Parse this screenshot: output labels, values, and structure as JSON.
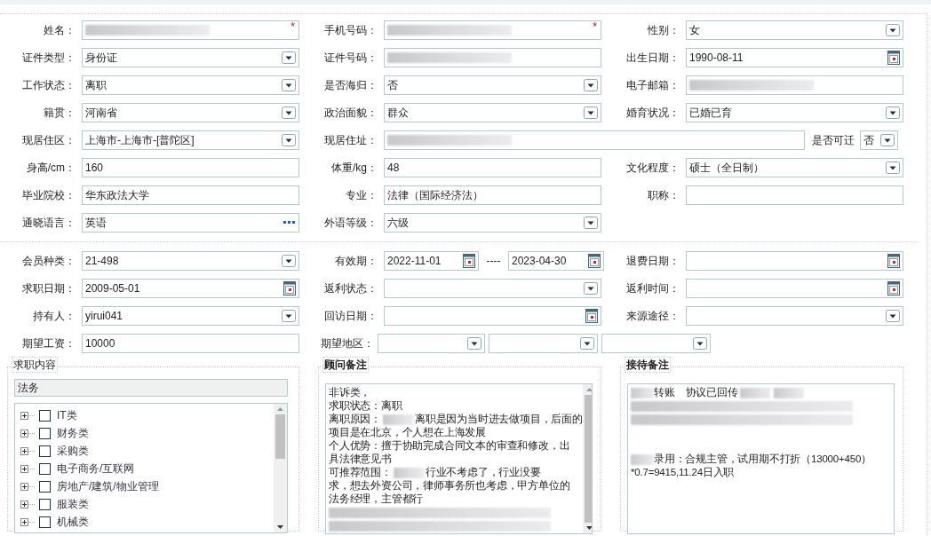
{
  "section_1": {
    "rows": [
      [
        {
          "label": "姓名：",
          "kind": "redacted",
          "required_mark": "*"
        },
        {
          "label": "手机号码：",
          "kind": "redacted",
          "required_mark": "*"
        },
        {
          "label": "性别：",
          "kind": "select",
          "value": "女"
        }
      ],
      [
        {
          "label": "证件类型：",
          "kind": "select",
          "value": "身份证"
        },
        {
          "label": "证件号码：",
          "kind": "redacted"
        },
        {
          "label": "出生日期：",
          "kind": "date",
          "value": "1990-08-11"
        }
      ],
      [
        {
          "label": "工作状态：",
          "kind": "select",
          "value": "离职"
        },
        {
          "label": "是否海归：",
          "kind": "select",
          "value": "否"
        },
        {
          "label": "电子邮箱：",
          "kind": "redacted"
        }
      ],
      [
        {
          "label": "籍贯：",
          "kind": "select",
          "value": "河南省"
        },
        {
          "label": "政治面貌：",
          "kind": "select",
          "value": "群众"
        },
        {
          "label": "婚育状况：",
          "kind": "select",
          "value": "已婚已育"
        }
      ],
      [
        {
          "label": "现居住区：",
          "kind": "select",
          "value": "上海市-上海市-[普陀区]"
        },
        {
          "label": "现居住址：",
          "kind": "redacted-wide"
        },
        {
          "label": "是否可迁",
          "kind": "inline-select",
          "value": "否"
        }
      ],
      [
        {
          "label": "身高/cm：",
          "kind": "text",
          "value": "160"
        },
        {
          "label": "体重/kg：",
          "kind": "text",
          "value": "48"
        },
        {
          "label": "文化程度：",
          "kind": "select",
          "value": "硕士（全日制）"
        }
      ],
      [
        {
          "label": "毕业院校：",
          "kind": "text",
          "value": "华东政法大学"
        },
        {
          "label": "专业：",
          "kind": "text",
          "value": "法律（国际经济法）"
        },
        {
          "label": "职称：",
          "kind": "text"
        }
      ],
      [
        {
          "label": "通晓语言：",
          "kind": "lookup",
          "value": "英语"
        },
        {
          "label": "外语等级：",
          "kind": "select",
          "value": "六级"
        }
      ]
    ]
  },
  "section_2": {
    "rows": [
      [
        {
          "label": "会员种类：",
          "kind": "select",
          "value": "21-498"
        },
        {
          "label": "有效期：",
          "kind": "date-range",
          "from": "2022-11-01",
          "separator": "----",
          "to": "2023-04-30"
        },
        {
          "label": "退费日期：",
          "kind": "date"
        }
      ],
      [
        {
          "label": "求职日期：",
          "kind": "date",
          "value": "2009-05-01"
        },
        {
          "label": "返利状态：",
          "kind": "select"
        },
        {
          "label": "返利时间：",
          "kind": "date"
        }
      ],
      [
        {
          "label": "持有人：",
          "kind": "select",
          "value": "yirui041"
        },
        {
          "label": "回访日期：",
          "kind": "date"
        },
        {
          "label": "来源途径：",
          "kind": "select"
        }
      ],
      [
        {
          "label": "期望工资：",
          "kind": "text",
          "value": "10000"
        },
        {
          "label": "期望地区：",
          "kind": "triple-select"
        }
      ]
    ]
  },
  "job_content": {
    "legend": "求职内容",
    "filter": "法务",
    "items": [
      {
        "label": "IT类",
        "expanded": false,
        "checked": false
      },
      {
        "label": "财务类",
        "expanded": false,
        "checked": false
      },
      {
        "label": "采购类",
        "expanded": false,
        "checked": false
      },
      {
        "label": "电子商务/互联网",
        "expanded": false,
        "checked": false
      },
      {
        "label": "房地产/建筑/物业管理",
        "expanded": false,
        "checked": false
      },
      {
        "label": "服装类",
        "expanded": false,
        "checked": false
      },
      {
        "label": "机械类",
        "expanded": false,
        "checked": false
      }
    ]
  },
  "consultant_notes": {
    "legend": "顾问备注",
    "lines": [
      [
        {
          "kind": "text",
          "text": "非诉类，"
        }
      ],
      [
        {
          "kind": "text",
          "text": "求职状态：离职"
        }
      ],
      [
        {
          "kind": "text",
          "text": "离职原因："
        },
        {
          "kind": "redacted"
        },
        {
          "kind": "text",
          "text": "离职是因为当时进去做项目，后面的"
        }
      ],
      [
        {
          "kind": "text",
          "text": "项目是在北京，个人想在上海发展"
        }
      ],
      [
        {
          "kind": "text",
          "text": "个人优势：擅于协助完成合同文本的审查和修改，出"
        }
      ],
      [
        {
          "kind": "text",
          "text": "具法律意见书"
        }
      ],
      [
        {
          "kind": "text",
          "text": "可推荐范围："
        },
        {
          "kind": "redacted"
        },
        {
          "kind": "text",
          "text": "行业不考虑了，行业没要"
        }
      ],
      [
        {
          "kind": "text",
          "text": "求，想去外资公司，律师事务所也考虑，甲方单位的"
        }
      ],
      [
        {
          "kind": "text",
          "text": "法务经理，主管都行"
        }
      ],
      [
        {
          "kind": "redacted-line"
        }
      ],
      [
        {
          "kind": "redacted-line"
        }
      ]
    ]
  },
  "reception_notes": {
    "legend": "接待备注",
    "lines": [
      [
        {
          "kind": "redacted"
        },
        {
          "kind": "text",
          "text": "转账"
        },
        {
          "kind": "text",
          "text": "协议已回传"
        },
        {
          "kind": "redacted"
        },
        {
          "kind": "redacted"
        }
      ],
      [
        {
          "kind": "redacted-line"
        }
      ],
      [
        {
          "kind": "redacted-line"
        }
      ],
      [
        {
          "kind": "blank"
        }
      ],
      [
        {
          "kind": "blank"
        }
      ],
      [
        {
          "kind": "redacted"
        },
        {
          "kind": "text",
          "text": "录用：合规主管，试用期不打折（13000+450）"
        }
      ],
      [
        {
          "kind": "text",
          "text": "*0.7=9415,11.24日入职"
        }
      ]
    ]
  }
}
